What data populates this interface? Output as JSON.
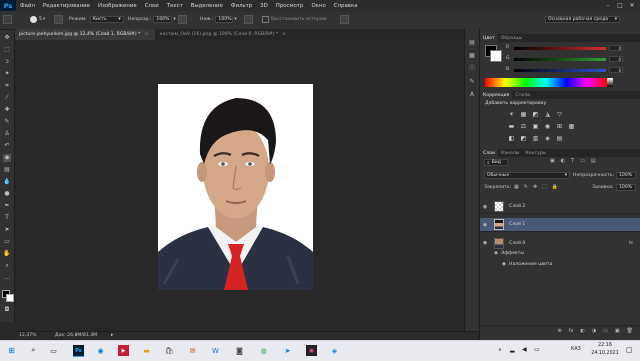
{
  "app": {
    "logo": "Ps",
    "menu": [
      "Файл",
      "Редактирование",
      "Изображение",
      "Слои",
      "Текст",
      "Выделение",
      "Фильтр",
      "3D",
      "Просмотр",
      "Окно",
      "Справка"
    ],
    "window_controls": [
      "–",
      "□",
      "✕"
    ]
  },
  "options": {
    "brush_size": "5",
    "mode_label": "Режим:",
    "mode_value": "Кисть",
    "opacity_label": "Непрозр.:",
    "opacity_value": "100%",
    "smoothing_label": "Нaж.:",
    "smoothing_value": "100%",
    "restore_label": "Восстановить историю",
    "workspace": "Основная рабочая среда"
  },
  "tabs": [
    {
      "label": "picture-jaehyunkim.jpg @ 12,4% (Слой 1, RGB/8#) *",
      "active": true,
      "close": "×"
    },
    {
      "label": "костюм_ОиV (16).png @ 100% (Слой 0, RGB/8#) *",
      "active": false,
      "close": "×"
    }
  ],
  "status": {
    "zoom": "12,37%",
    "doc": "Док: 26,8M/81,3M",
    "arrow": "▸"
  },
  "color_panel": {
    "tabs": [
      "Цвет",
      "Образцы"
    ],
    "rows": [
      {
        "letter": "R",
        "value": "0"
      },
      {
        "letter": "G",
        "value": "0"
      },
      {
        "letter": "B",
        "value": "0"
      }
    ]
  },
  "adjustments_panel": {
    "tabs": [
      "Коррекция",
      "Стили"
    ],
    "title": "Добавить корректировку",
    "icons_row1": [
      "☀",
      "▦",
      "◩",
      "◮",
      "▽"
    ],
    "icons_row2": [
      "▬",
      "⚖",
      "▣",
      "◉",
      "⊞",
      "▦"
    ],
    "icons_row3": [
      "◧",
      "◩",
      "▥",
      "◈",
      "▤"
    ]
  },
  "layers_panel": {
    "tabs": [
      "Слои",
      "Каналы",
      "Контуры"
    ],
    "kind_label": "Вид",
    "blend_mode": "Обычные",
    "opacity_label": "Непрозрачность:",
    "opacity_value": "100%",
    "lock_label": "Закрепить:",
    "fill_label": "Заливка:",
    "fill_value": "100%",
    "fx": "fx",
    "layers": [
      {
        "name": "Слой 2",
        "selected": false
      },
      {
        "name": "Слой 1",
        "selected": true
      },
      {
        "name": "Слой 0",
        "selected": false
      }
    ],
    "effects_label": "Эффекты",
    "effect_item": "Наложение цвета",
    "footer_icons": [
      "⊕",
      "fx",
      "◐",
      "◑",
      "▭",
      "▣",
      "🗑"
    ]
  },
  "taskbar": {
    "search_icon": "⌕",
    "time": "22:16",
    "date": "24.10.2021",
    "lang": "КАЗ",
    "tray": "∧"
  },
  "colors": {
    "ps_blue": "#31a8ff",
    "slider_r": "#d03030",
    "slider_g": "#30a030",
    "slider_b": "#3050d0",
    "layer_selected": "#4a5975",
    "taskbar_bg": "#e8eaf0"
  }
}
